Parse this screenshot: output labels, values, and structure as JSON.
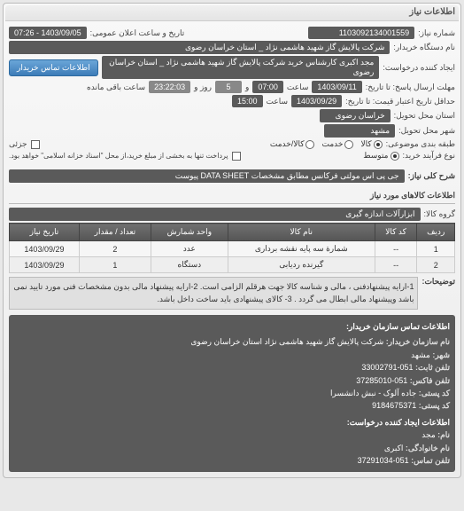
{
  "panel_title": "اطلاعات نیاز",
  "fields": {
    "need_number_lbl": "شماره نیاز:",
    "need_number": "1103092134001559",
    "announce_lbl": "تاریخ و ساعت اعلان عمومی:",
    "announce_val": "1403/09/05 - 07:26",
    "buyer_org_lbl": "نام دستگاه خریدار:",
    "buyer_org": "شرکت پالایش گاز شهید هاشمی نژاد _ استان خراسان رضوی",
    "requester_lbl": "ایجاد کننده درخواست:",
    "requester": "مجد اکبری کارشناس خرید شرکت پالایش گاز شهید هاشمی نژاد _ استان خراسان رضوی",
    "contact_btn": "اطلاعات تماس خریدار",
    "deadline_lbl": "مهلت ارسال پاسخ: تا تاریخ:",
    "deadline_date": "1403/09/11",
    "time_lbl": "ساعت",
    "deadline_time": "07:00",
    "and_lbl": "و",
    "day_val": "5",
    "day_lbl": "روز و",
    "remain_val": "23:22:03",
    "remain_lbl": "ساعت باقی مانده",
    "valid_lbl": "حداقل تاریخ اعتبار قیمت: تا تاریخ:",
    "valid_date": "1403/09/29",
    "valid_time": "15:00",
    "province_lbl": "استان محل تحویل:",
    "province": "خراسان رضوی",
    "city_lbl": "شهر محل تحویل:",
    "city": "مشهد",
    "category_lbl": "طبقه بندی موضوعی:",
    "cat_goods": "کالا",
    "cat_service": "خدمت",
    "cat_both": "کالا/خدمت",
    "partial_lbl": "جزئی",
    "process_lbl": "نوع فرآیند خرید:",
    "proc_low": "متوسط",
    "proc_note": "پرداخت تنها به بخشی از مبلغ خرید،از محل \"اسناد خزانه اسلامی\" خواهد بود.",
    "desc_lbl": "شرح کلی نیاز:",
    "desc_val": "جی پی اس مولتی فرکانس مطابق مشخصات DATA SHEET پیوست",
    "goods_title": "اطلاعات کالاهای مورد نیاز",
    "group_lbl": "گروه کالا:",
    "group_val": "ابزارآلات اندازه گیری",
    "th_row": "ردیف",
    "th_code": "کد کالا",
    "th_name": "نام کالا",
    "th_unit": "واحد شمارش",
    "th_qty": "تعداد / مقدار",
    "th_date": "تاریخ نیاز",
    "rows": [
      {
        "row": "1",
        "code": "--",
        "name": "شمارة سه پایه نقشه برداری",
        "unit": "عدد",
        "qty": "2",
        "date": "1403/09/29"
      },
      {
        "row": "2",
        "code": "--",
        "name": "گیرنده ردیابی",
        "unit": "دستگاه",
        "qty": "1",
        "date": "1403/09/29"
      }
    ],
    "notes_lbl": "توضیحات:",
    "notes_val": "1-ارایه پیشنهادفنی ، مالی و شناسه کالا جهت هرقلم الزامی است. 2-ارایه پیشنهاد مالی بدون مشخصات فنی مورد تایید نمی باشد وپیشنهاد مالی ابطال می گردد . 3- کالای پیشنهادی باید ساخت داخل باشد.",
    "contact_title": "اطلاعات تماس سازمان خریدار:",
    "c_org_lbl": "نام سازمان خریدار:",
    "c_org": "شرکت پالایش گاز شهید هاشمی نژاد استان خراسان رضوی",
    "c_city_lbl": "شهر:",
    "c_city": "مشهد",
    "c_tel_lbl": "تلفن ثابت:",
    "c_tel": "051-33002791",
    "c_fax_lbl": "تلفن فاکس:",
    "c_fax": "051-37285010",
    "c_post_lbl": "کد پستی:",
    "c_post": "جاده آلوک - نبش دانشسرا",
    "c_postcode_lbl": "کد پستی:",
    "c_postcode": "9184675371",
    "creator_title": "اطلاعات ایجاد کننده درخواست:",
    "fname_lbl": "نام:",
    "fname": "مجد",
    "lname_lbl": "نام خانوادگی:",
    "lname": "اکبری",
    "ctel_lbl": "تلفن تماس:",
    "ctel": "051-37291034"
  }
}
